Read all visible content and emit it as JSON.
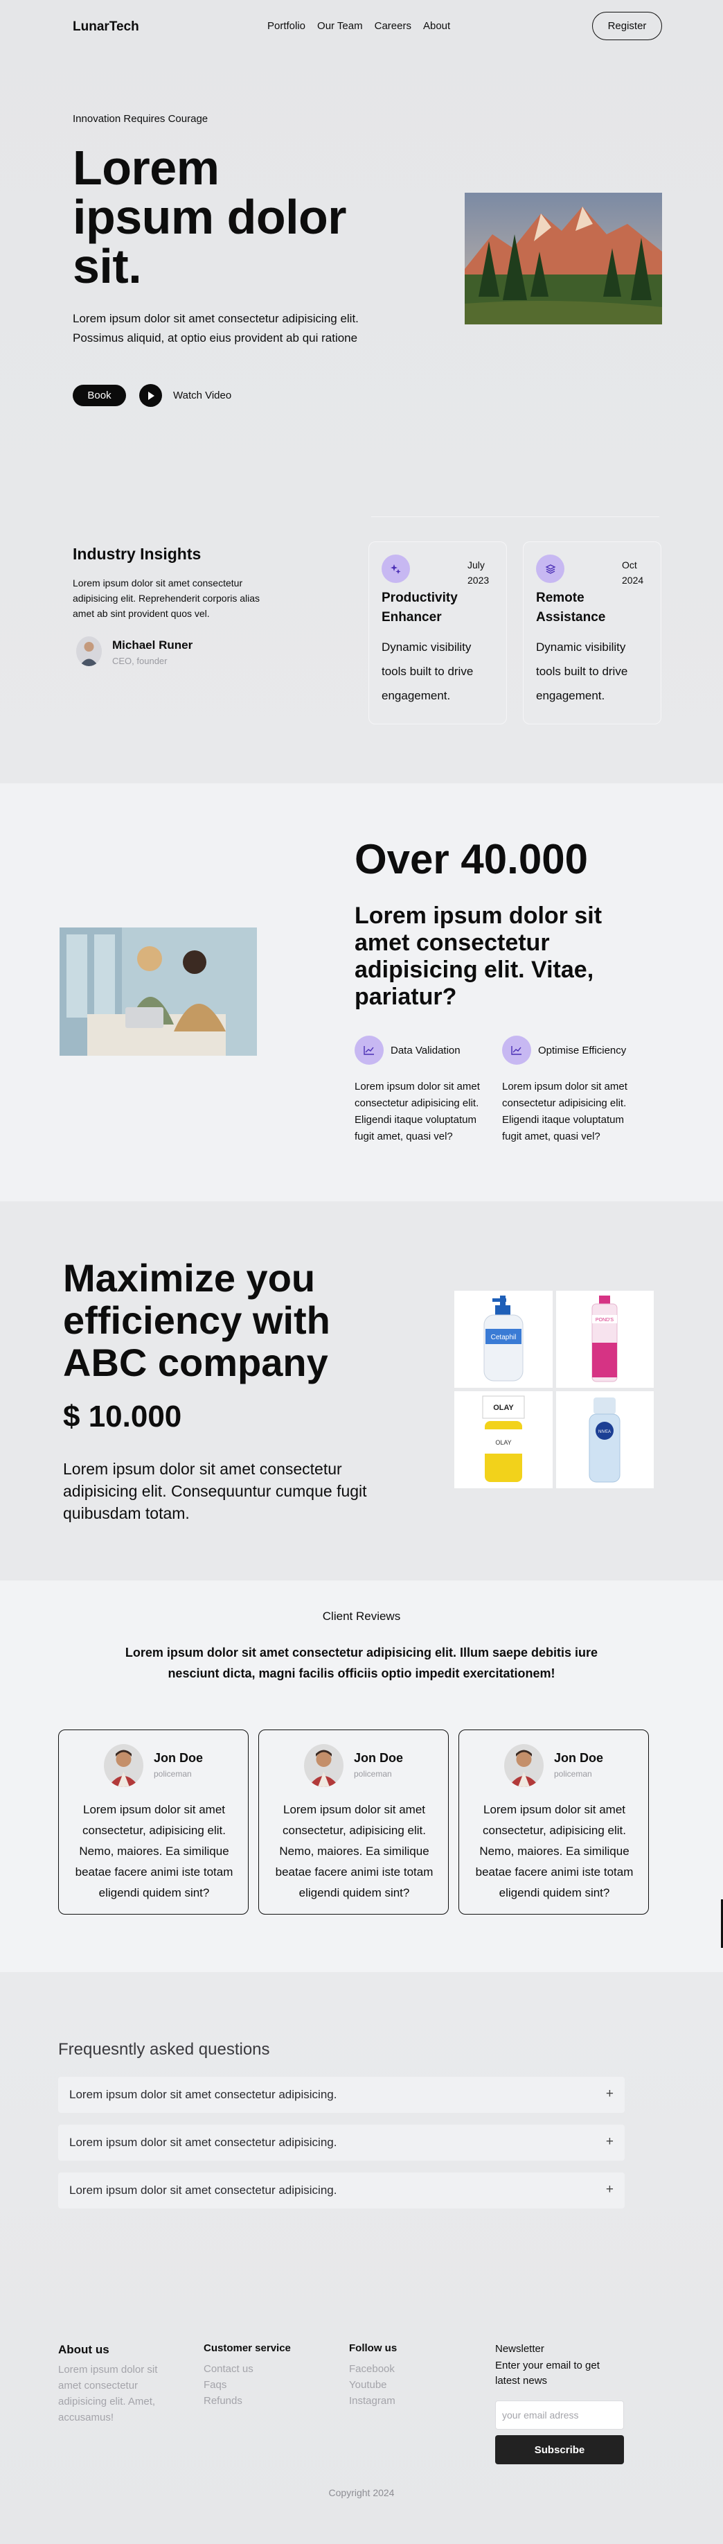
{
  "header": {
    "logo": "LunarTech",
    "nav": [
      "Portfolio",
      "Our Team",
      "Careers",
      "About"
    ],
    "register_label": "Register"
  },
  "hero": {
    "tagline": "Innovation Requires Courage",
    "title": "Lorem ipsum dolor sit.",
    "description": "Lorem ipsum dolor sit amet consectetur adipisicing elit. Possimus aliquid, at optio eius provident ab qui ratione",
    "book_label": "Book",
    "watch_label": "Watch Video"
  },
  "insights": {
    "title": "Industry Insights",
    "description": "Lorem ipsum dolor sit amet consectetur adipisicing elit. Reprehenderit corporis alias amet ab sint provident quos vel.",
    "person_name": "Michael Runer",
    "person_role": "CEO, founder",
    "cards": [
      {
        "date": "July 2023",
        "title": "Productivity Enhancer",
        "description": "Dynamic visibility tools built to drive engagement.",
        "icon": "sparkle-icon"
      },
      {
        "date": "Oct 2024",
        "title": "Remote Assistance",
        "description": "Dynamic visibility tools built to drive engagement.",
        "icon": "layers-icon"
      }
    ]
  },
  "stats": {
    "big": "Over 40.000",
    "subtitle": "Lorem ipsum dolor sit amet consectetur adipisicing elit. Vitae, pariatur?",
    "features": [
      {
        "label": "Data Validation",
        "description": "Lorem ipsum dolor sit amet consectetur adipisicing elit. Eligendi itaque voluptatum fugit amet, quasi vel?",
        "icon": "chart-line-icon"
      },
      {
        "label": "Optimise Efficiency",
        "description": "Lorem ipsum dolor sit amet consectetur adipisicing elit. Eligendi itaque voluptatum fugit amet, quasi vel?",
        "icon": "chart-line-icon"
      }
    ]
  },
  "product": {
    "title": "Maximize you efficiency with ABC company",
    "price": "$ 10.000",
    "description": "Lorem ipsum dolor sit amet consectetur adipisicing elit. Consequuntur cumque fugit quibusdam totam.",
    "images": [
      {
        "brand": "Cetaphil",
        "color": "#3a7bd5"
      },
      {
        "brand": "POND'S",
        "color": "#d63384"
      },
      {
        "brand": "OLAY",
        "color": "#f2d21b"
      },
      {
        "brand": "NIVEA",
        "color": "#1c3f94"
      }
    ]
  },
  "reviews": {
    "heading": "Client Reviews",
    "lead": "Lorem ipsum dolor sit amet consectetur adipisicing elit. Illum saepe debitis iure nesciunt dicta, magni facilis officiis optio impedit exercitationem!",
    "items": [
      {
        "name": "Jon Doe",
        "role": "policeman",
        "text": "Lorem ipsum dolor sit amet consectetur, adipisicing elit. Nemo, maiores. Ea similique beatae facere animi iste totam eligendi quidem sint?"
      },
      {
        "name": "Jon Doe",
        "role": "policeman",
        "text": "Lorem ipsum dolor sit amet consectetur, adipisicing elit. Nemo, maiores. Ea similique beatae facere animi iste totam eligendi quidem sint?"
      },
      {
        "name": "Jon Doe",
        "role": "policeman",
        "text": "Lorem ipsum dolor sit amet consectetur, adipisicing elit. Nemo, maiores. Ea similique beatae facere animi iste totam eligendi quidem sint?"
      }
    ]
  },
  "faq": {
    "title": "Frequesntly asked questions",
    "items": [
      {
        "question": "Lorem ipsum dolor sit amet consectetur adipisicing.",
        "toggle": "+"
      },
      {
        "question": "Lorem ipsum dolor sit amet consectetur adipisicing.",
        "toggle": "+"
      },
      {
        "question": "Lorem ipsum dolor sit amet consectetur adipisicing.",
        "toggle": "+"
      }
    ]
  },
  "footer": {
    "about_title": "About us",
    "about_text": "Lorem ipsum dolor sit amet consectetur adipisicing elit. Amet, accusamus!",
    "service_title": "Customer service",
    "service_links": [
      "Contact us",
      "Faqs",
      "Refunds"
    ],
    "follow_title": "Follow us",
    "follow_links": [
      "Facebook",
      "Youtube",
      "Instagram"
    ],
    "newsletter_title": "Newsletter",
    "newsletter_text": "Enter your email to get latest news",
    "email_placeholder": "your email adress",
    "subscribe_label": "Subscribe",
    "copyright": "Copyright 2024"
  }
}
